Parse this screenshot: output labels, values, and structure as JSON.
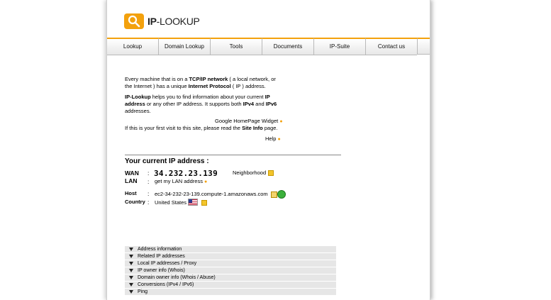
{
  "logo": {
    "brand": "IP",
    "name": "-LOOKUP"
  },
  "nav": [
    "Lookup",
    "Domain Lookup",
    "Tools",
    "Documents",
    "IP-Suite",
    "Contact us"
  ],
  "intro": {
    "p1_a": "Every machine that is on a ",
    "p1_b": "TCP/IP network",
    "p1_c": " ( a local network, or the Internet ) has a unique ",
    "p1_d": "Internet Protocol",
    "p1_e": " ( IP ) address.",
    "p2_a": "IP-Lookup",
    "p2_b": " helps you to find information about your current ",
    "p2_c": "IP address",
    "p2_d": " or any other IP address. It supports both ",
    "p2_e": "IPv4",
    "p2_f": " and ",
    "p2_g": "IPv6",
    "p2_h": " addresses."
  },
  "widget_link": "Google HomePage Widget",
  "first_visit": {
    "a": "If this is your first visit to this site, please read the ",
    "b": "Site Info",
    "c": " page."
  },
  "help": "Help",
  "ip": {
    "title": "Your current IP address :",
    "wan_label": "WAN",
    "wan_value": "34.232.23.139",
    "neighborhood": "Neighborhood",
    "lan_label": "LAN",
    "lan_value": "get my LAN address",
    "host_label": "Host",
    "host_value": "ec2-34-232-23-139.compute-1.amazonaws.com",
    "country_label": "Country",
    "country_value": "United States",
    "colon": ":"
  },
  "accordion": [
    "Address information",
    "Related IP addresses",
    "Local IP addresses / Proxy",
    "IP owner info (Whois)",
    "Domain owner info (Whois / Abuse)",
    "Conversions (IPv4 / IPv6)",
    "Ping"
  ],
  "colors": {
    "accent": "#f3a10d"
  }
}
